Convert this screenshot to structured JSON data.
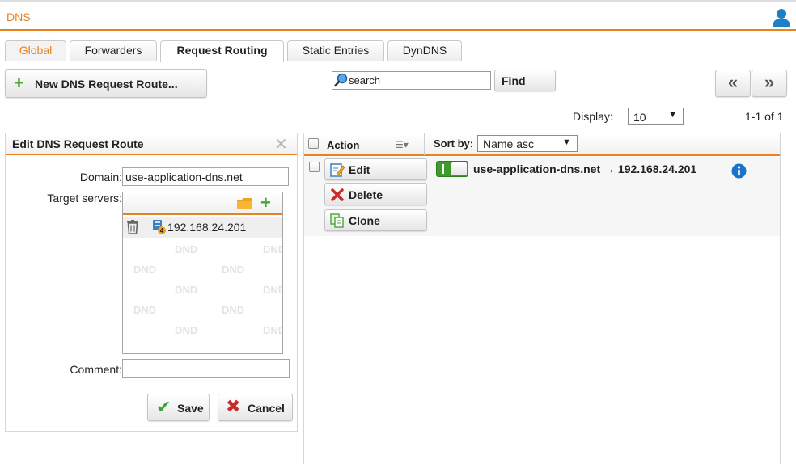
{
  "app": {
    "title": "DNS"
  },
  "tabs": [
    {
      "label": "Global"
    },
    {
      "label": "Forwarders"
    },
    {
      "label": "Request Routing",
      "active": true
    },
    {
      "label": "Static Entries"
    },
    {
      "label": "DynDNS"
    }
  ],
  "toolbar": {
    "new_route_label": "New DNS Request Route...",
    "search_value": "search",
    "find_label": "Find",
    "prev_label": "«",
    "next_label": "»"
  },
  "paging": {
    "display_label": "Display:",
    "display_value": "10",
    "info": "1-1 of 1"
  },
  "edit_panel": {
    "title": "Edit DNS Request Route",
    "domain_label": "Domain:",
    "domain_value": "use-application-dns.net",
    "target_label": "Target servers:",
    "targets": [
      {
        "ip": "192.168.24.201"
      }
    ],
    "watermark": "DND",
    "comment_label": "Comment:",
    "comment_value": "",
    "save_label": "Save",
    "cancel_label": "Cancel"
  },
  "list_panel": {
    "action_header": "Action",
    "sortby_label": "Sort by:",
    "sort_value": "Name asc",
    "entries": [
      {
        "text": "use-application-dns.net → 192.168.24.201",
        "enabled": true,
        "edit_label": "Edit",
        "delete_label": "Delete",
        "clone_label": "Clone"
      }
    ]
  },
  "colors": {
    "accent": "#e8821e",
    "toggle_on": "#3e9a2b",
    "add_green": "#4aa53a",
    "cancel_red": "#cc2b2b",
    "info_blue": "#1a73c9"
  },
  "icons": [
    "user-icon",
    "plus-icon",
    "search-icon",
    "close-icon",
    "folder-icon",
    "trash-icon",
    "server-icon",
    "checkmark-icon",
    "x-icon",
    "edit-icon",
    "delete-icon",
    "clone-icon",
    "info-icon",
    "column-menu-icon",
    "chevron-down-icon"
  ]
}
